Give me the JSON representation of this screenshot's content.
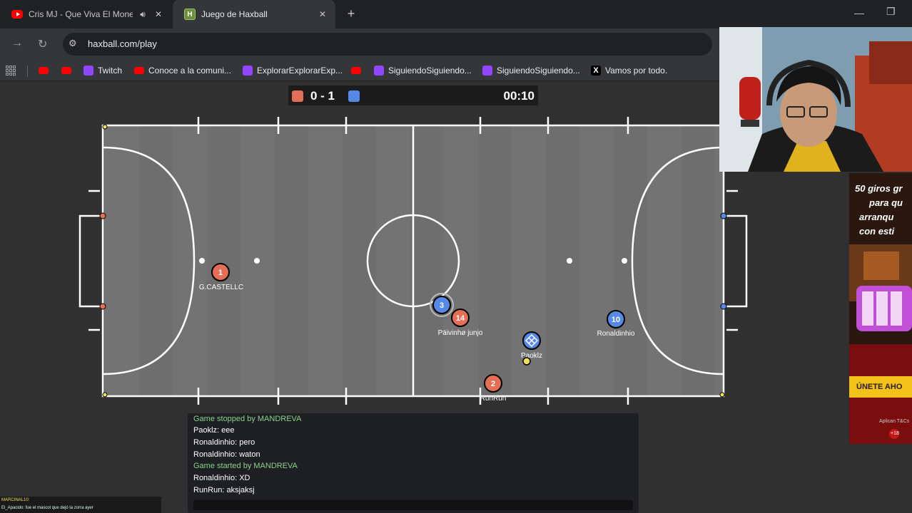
{
  "browser": {
    "tabs": [
      {
        "title": "Cris MJ - Que Viva El Mone",
        "favicon": "youtube-icon",
        "audio_icon": "speaker-icon",
        "close": "✕",
        "active": false
      },
      {
        "title": "Juego de Haxball",
        "favicon": "haxball-icon",
        "close": "✕",
        "active": true
      }
    ],
    "new_tab": "+",
    "url": "haxball.com/play",
    "bookmarks": [
      {
        "label": "",
        "icon": "youtube-icon"
      },
      {
        "label": "",
        "icon": "youtube-icon"
      },
      {
        "label": "Twitch",
        "icon": "twitch-icon"
      },
      {
        "label": "Conoce a la comuni...",
        "icon": "youtube-icon"
      },
      {
        "label": "ExplorarExplorarExp...",
        "icon": "twitch-icon"
      },
      {
        "label": "",
        "icon": "youtube-icon"
      },
      {
        "label": "SiguiendoSiguiendo...",
        "icon": "twitch-icon"
      },
      {
        "label": "SiguiendoSiguiendo...",
        "icon": "twitch-icon"
      },
      {
        "label": "Vamos por todo.",
        "icon": "x-icon"
      }
    ]
  },
  "scoreboard": {
    "red_color": "#e56e56",
    "blue_color": "#5689e5",
    "score": "0 - 1",
    "timer": "00:10"
  },
  "players": [
    {
      "number": "1",
      "name": "G.CASTELLC",
      "team": "red"
    },
    {
      "number": "3",
      "name": "",
      "team": "blue"
    },
    {
      "number": "14",
      "name": "Päivinhø junjo",
      "team": "red"
    },
    {
      "number": "",
      "name": "Paoklz",
      "team": "blue"
    },
    {
      "number": "10",
      "name": "Ronaldinhio",
      "team": "blue"
    },
    {
      "number": "2",
      "name": "RunRun",
      "team": "red"
    }
  ],
  "chat": {
    "lines": [
      {
        "text": "Game stopped by MANDREVA",
        "system": true
      },
      {
        "text": "Paoklz: eee",
        "system": false
      },
      {
        "text": "Ronaldinhio: pero",
        "system": false
      },
      {
        "text": "Ronaldinhio: waton",
        "system": false
      },
      {
        "text": "Game started by MANDREVA",
        "system": true
      },
      {
        "text": "Ronaldinhio: XD",
        "system": false
      },
      {
        "text": "RunRun: aksjaksj",
        "system": false
      }
    ]
  },
  "ad": {
    "lines": [
      "50 giros gr",
      "para qu",
      "arranqu",
      "con esti"
    ],
    "cta": "ÚNETE AHO",
    "fine": "Aplican T&Cs",
    "age": "+18"
  },
  "stream_chat": {
    "lines": [
      "MARCINAL10:",
      "El_Apacido: fue el mascol que dejó la zorra ayer"
    ]
  }
}
